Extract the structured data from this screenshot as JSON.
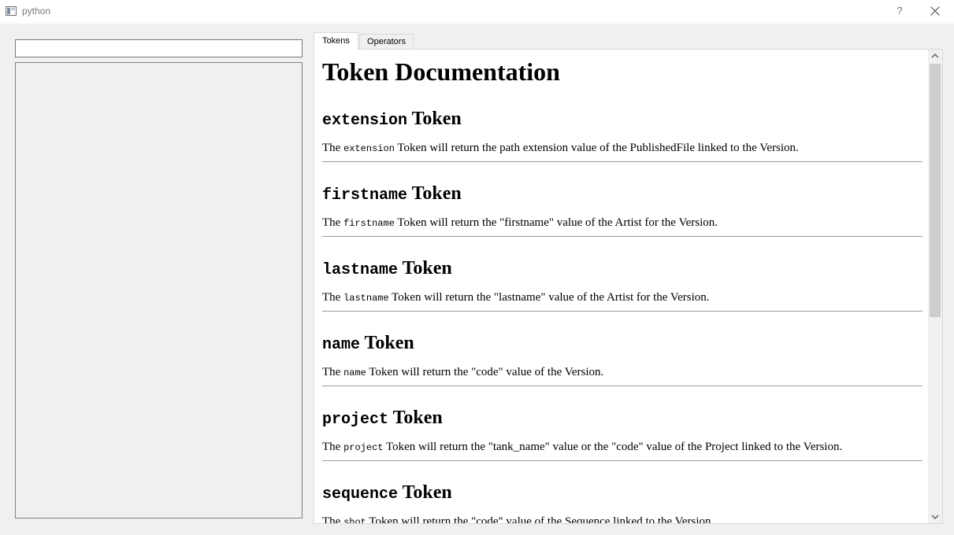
{
  "window": {
    "title": "python",
    "help_label": "?"
  },
  "search": {
    "value": "",
    "placeholder": ""
  },
  "tabs": [
    {
      "label": "Tokens",
      "selected": true
    },
    {
      "label": "Operators",
      "selected": false
    }
  ],
  "doc": {
    "title": "Token Documentation",
    "sections": [
      {
        "token": "extension",
        "suffix": " Token",
        "desc_before": "The ",
        "desc_code": "extension",
        "desc_after": " Token will return the path extension value of the PublishedFile linked to the Version."
      },
      {
        "token": "firstname",
        "suffix": " Token",
        "desc_before": "The ",
        "desc_code": "firstname",
        "desc_after": " Token will return the \"firstname\" value of the Artist for the Version."
      },
      {
        "token": "lastname",
        "suffix": " Token",
        "desc_before": "The ",
        "desc_code": "lastname",
        "desc_after": " Token will return the \"lastname\" value of the Artist for the Version."
      },
      {
        "token": "name",
        "suffix": " Token",
        "desc_before": "The ",
        "desc_code": "name",
        "desc_after": " Token will return the \"code\" value of the Version."
      },
      {
        "token": "project",
        "suffix": " Token",
        "desc_before": "The ",
        "desc_code": "project",
        "desc_after": " Token will return the \"tank_name\" value or the \"code\" value of the Project linked to the Version."
      },
      {
        "token": "sequence",
        "suffix": " Token",
        "desc_before": "The ",
        "desc_code": "shot",
        "desc_after": " Token will return the \"code\" value of the Sequence linked to the Version."
      }
    ]
  },
  "icons": {
    "app": "window-icon",
    "close": "close-icon",
    "scroll_up": "chevron-up-icon",
    "scroll_down": "chevron-down-icon"
  },
  "colors": {
    "background": "#f0f0f0",
    "scroll_thumb": "#cdcdcd"
  }
}
